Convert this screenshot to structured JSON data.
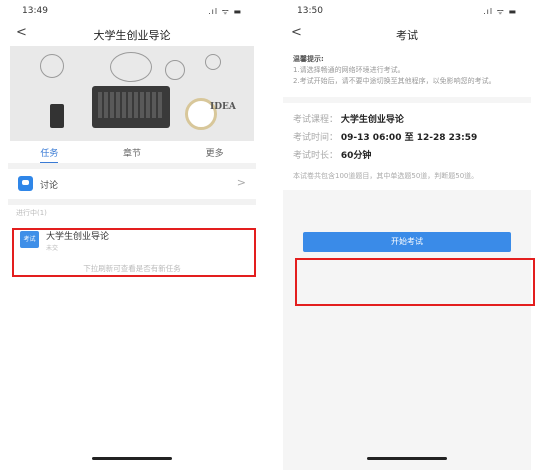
{
  "left": {
    "status_time": "13:49",
    "status_icons": ".ıl ᯤ ▬",
    "title": "大学生创业导论",
    "banner_text": "IDEA",
    "tabs": [
      "任务",
      "章节",
      "更多"
    ],
    "discussion_label": "讨论",
    "section_label": "进行中(1)",
    "task_icon_text": "考试",
    "task_title": "大学生创业导论",
    "task_sub": "未交",
    "hint": "下拉刷新可查看是否有新任务"
  },
  "right": {
    "status_time": "13:50",
    "status_icons": ".ıl ᯤ ▬",
    "title": "考试",
    "notice_title": "温馨提示:",
    "notice_lines": [
      "1.请选择畅通的网络环境进行考试。",
      "2.考试开始后，请不要中途切换至其他程序，以免影响您的考试。"
    ],
    "course_label": "考试课程：",
    "course_value": "大学生创业导论",
    "time_label": "考试时间：",
    "time_value": "09-13 06:00 至 12-28 23:59",
    "duration_label": "考试时长：",
    "duration_value": "60分钟",
    "desc": "本试卷共包含100道题目，其中单选题50道，判断题50道。",
    "start_button": "开始考试"
  },
  "colors": {
    "accent": "#3a8be8",
    "highlight": "#e31e1e"
  }
}
